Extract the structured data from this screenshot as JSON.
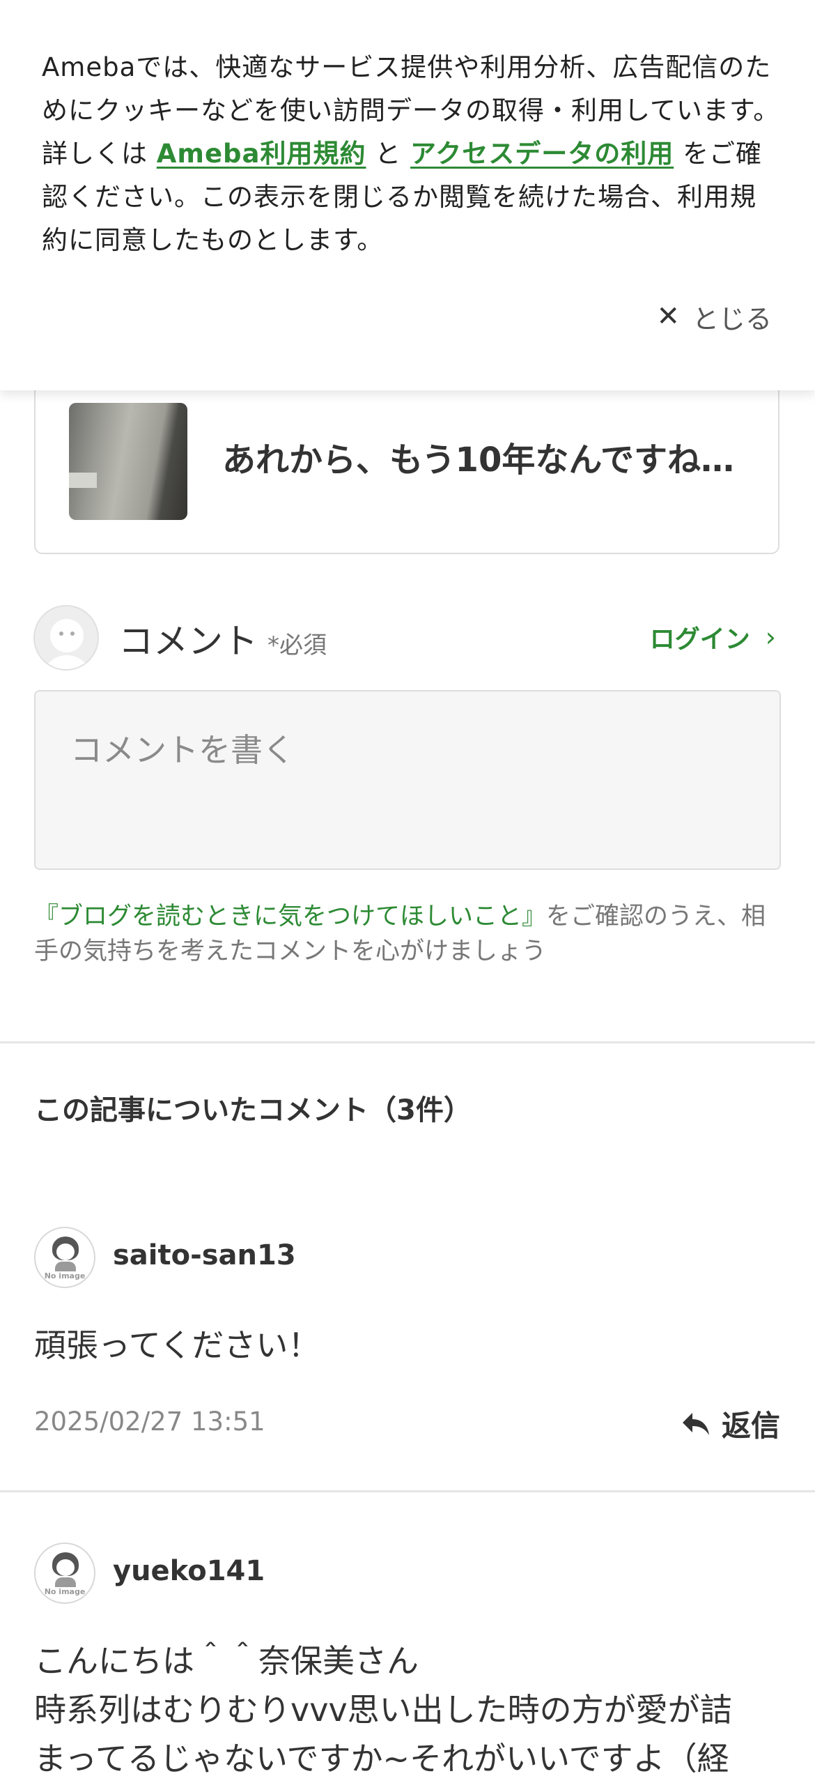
{
  "cookie_banner": {
    "text_before": "Amebaでは、快適なサービス提供や利用分析、広告配信のためにクッキーなどを使い訪問データの取得・利用しています。詳しくは ",
    "link1": "Ameba利用規約",
    "text_mid": " と ",
    "link2": "アクセスデータの利用",
    "text_after": " をご確認ください。この表示を閉じるか閲覧を続けた場合、利用規約に同意したものとします。",
    "close_label": "とじる",
    "close_icon": "close-icon"
  },
  "related_article": {
    "title": "あれから、もう10年なんですね…"
  },
  "comment_form": {
    "label": "コメント",
    "required": "*必須",
    "login": "ログイン",
    "placeholder": "コメントを書く",
    "guideline_link": "『ブログを読むときに気をつけてほしいこと』",
    "guideline_text": "をご確認のうえ、相手の気持ちを考えたコメントを心がけましょう"
  },
  "comments_section": {
    "title": "この記事についたコメント（3件）",
    "avatar_caption": "No image",
    "reply_label": "返信",
    "items": [
      {
        "name": "saito-san13",
        "body": "頑張ってください！",
        "date": "2025/02/27 13:51"
      },
      {
        "name": "yueko141",
        "body_line1": "こんにちは＾＾奈保美さん",
        "body_line2": "時系列はむりむりvvv思い出した時の方が愛が詰",
        "body_line3": "まってるじゃないですか~それがいいですよ（経"
      }
    ]
  },
  "colors": {
    "accent_green": "#2d8a34",
    "text": "#333333",
    "muted": "#888888"
  }
}
